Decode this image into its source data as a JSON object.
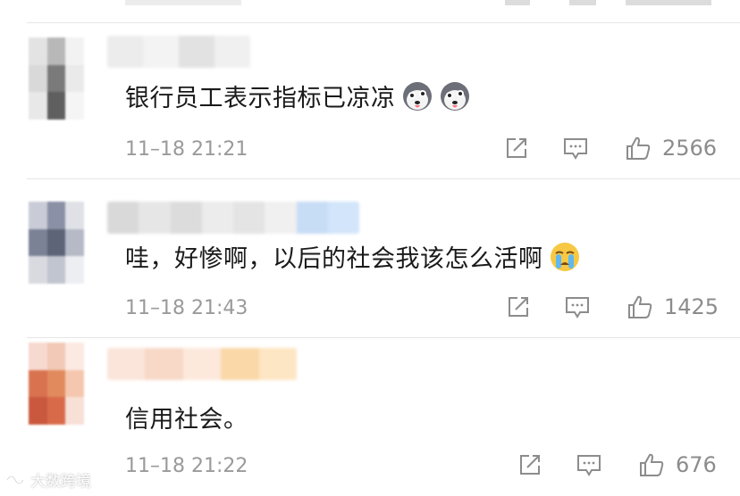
{
  "colors": {
    "text": "#1a1a1a",
    "meta": "#9a9a9a",
    "icon": "#8c8c8c",
    "divider": "#e6e6e6"
  },
  "comments": [
    {
      "text": "银行员工表示指标已凉凉",
      "emoji": [
        "husky-emoji",
        "husky-emoji"
      ],
      "time": "11–18 21:21",
      "likes": "2566"
    },
    {
      "text": "哇，好惨啊，以后的社会我该怎么活啊",
      "emoji": [
        "crying-face-emoji"
      ],
      "time": "11–18 21:43",
      "likes": "1425"
    },
    {
      "text": "信用社会。",
      "emoji": [],
      "time": "11–18 21:22",
      "likes": "676"
    }
  ],
  "icons": {
    "share": "share-icon",
    "comment": "comment-icon",
    "like": "thumbs-up-icon"
  },
  "watermark": {
    "text": "大数跨境"
  }
}
